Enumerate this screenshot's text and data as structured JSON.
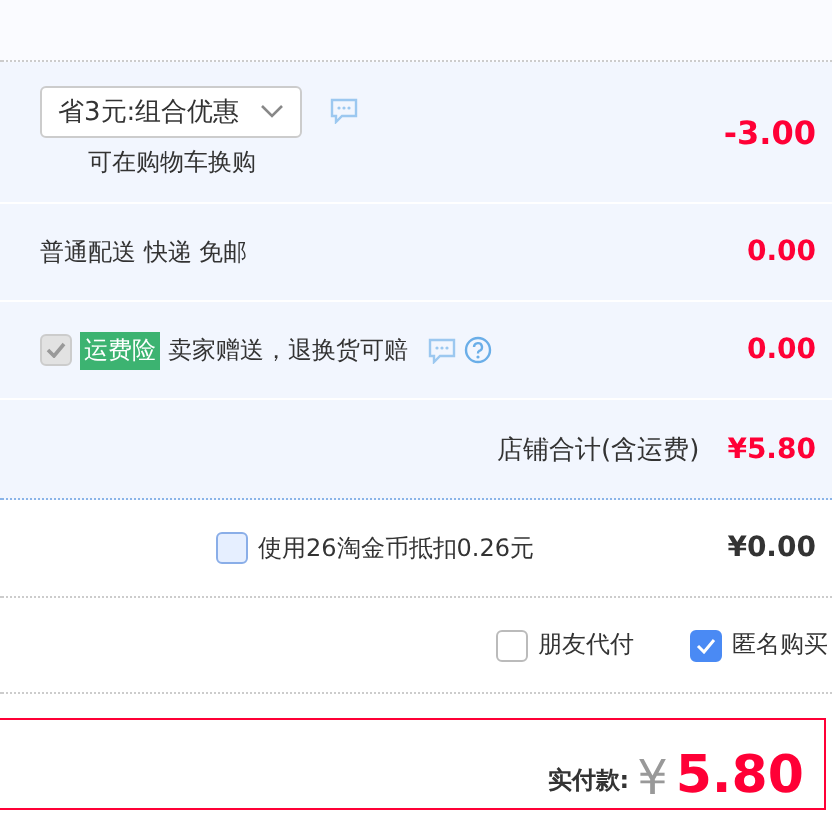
{
  "promo": {
    "dropdown": "省3元:组合优惠",
    "note": "可在购物车换购",
    "amount": "-3.00"
  },
  "shipping": {
    "label": "普通配送 快递 免邮",
    "amount": "0.00"
  },
  "insurance": {
    "checked": true,
    "disabled": true,
    "badge": "运费险",
    "text": "卖家赠送，退换货可赔",
    "amount": "0.00"
  },
  "store_total": {
    "label": "店铺合计(含运费)",
    "amount": "¥5.80"
  },
  "coins": {
    "checked": false,
    "label": "使用26淘金币抵扣0.26元",
    "amount": "¥0.00"
  },
  "options": [
    {
      "label": "朋友代付",
      "checked": false
    },
    {
      "label": "匿名购买",
      "checked": true
    }
  ],
  "payment": {
    "label": "实付款:",
    "currency": "¥",
    "amount": "5.80"
  }
}
